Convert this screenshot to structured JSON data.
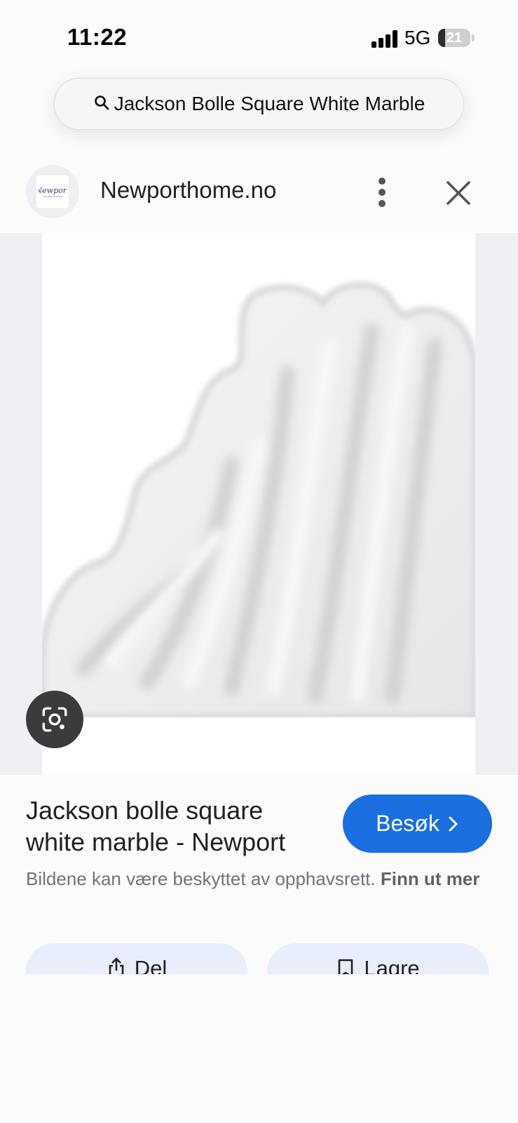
{
  "status_bar": {
    "time": "11:22",
    "network": "5G",
    "battery_level": "21"
  },
  "search": {
    "query": "Jackson Bolle Square White Marble",
    "icon": "search-icon"
  },
  "source": {
    "site_name": "Newporthome.no",
    "logo_text": "Newport",
    "more_icon": "more-vert-icon",
    "close_icon": "close-icon"
  },
  "image": {
    "lens_icon": "google-lens-icon"
  },
  "result": {
    "title": "Jackson bolle square white marble - Newport",
    "visit_label": "Besøk",
    "copyright_text": "Bildene kan være beskyttet av opphavsrett.",
    "learn_more_label": "Finn ut mer"
  },
  "actions": {
    "share_label": "Del",
    "save_label": "Lagre"
  },
  "colors": {
    "accent": "#1b6ee0",
    "action_bg": "#e8eefc",
    "lens_bg": "#3b3b3b"
  }
}
